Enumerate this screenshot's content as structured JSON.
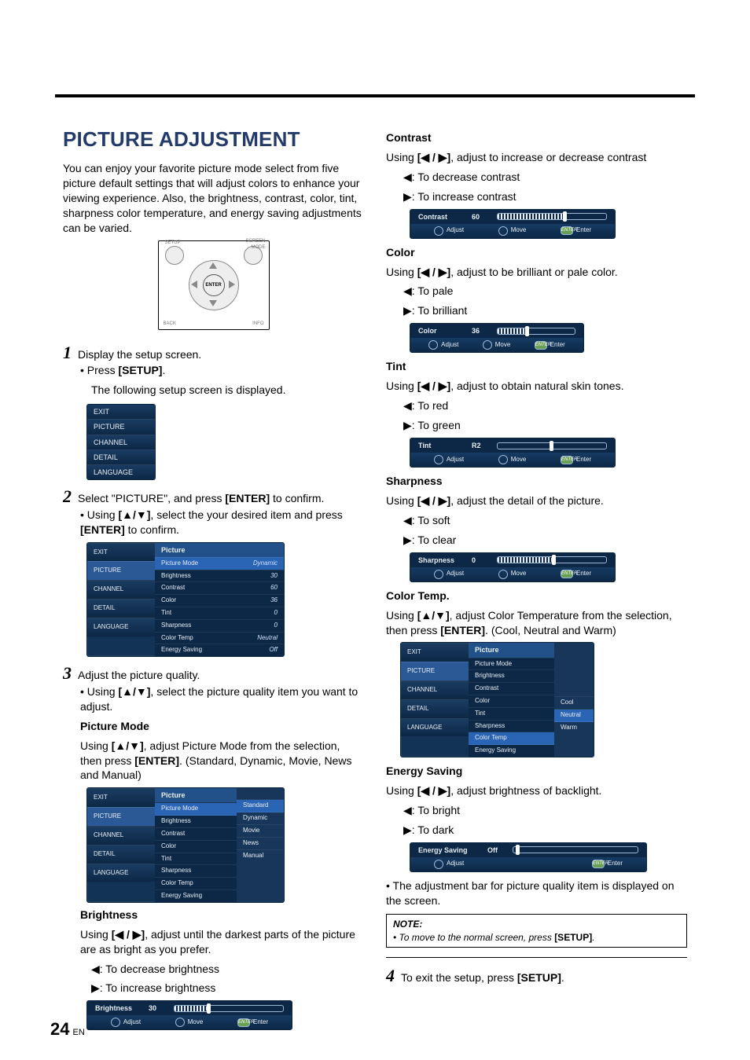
{
  "page": {
    "number": "24",
    "suffix": "EN"
  },
  "title": "PICTURE ADJUSTMENT",
  "intro": "You can enjoy your favorite picture mode select from five picture default settings that will adjust colors to enhance your viewing experience. Also, the brightness, contrast, color, tint, sharpness color temperature, and energy saving adjustments can be varied.",
  "remote": {
    "setup": "SETUP",
    "back": "BACK",
    "screen": "SCREEN MODE",
    "info": "INFO",
    "enter": "ENTER"
  },
  "steps": {
    "s1": {
      "num": "1",
      "text": "Display the setup screen.",
      "b1a": "• Press ",
      "b1b": "[SETUP]",
      "b1c": ".",
      "b2": "The following setup screen is displayed."
    },
    "s2": {
      "num": "2",
      "t1": "Select \"PICTURE\", and press ",
      "t2": "[ENTER]",
      "t3": " to confirm.",
      "b1a": "• Using ",
      "b1b": "[▲/▼]",
      "b1c": ", select the your desired item and press ",
      "b1d": "[ENTER]",
      "b1e": " to confirm."
    },
    "s3": {
      "num": "3",
      "text": "Adjust the picture quality.",
      "b1a": "• Using ",
      "b1b": "[▲/▼]",
      "b1c": ", select the picture quality item you want to adjust."
    },
    "s4": {
      "num": "4",
      "t1": "To exit the setup, press ",
      "t2": "[SETUP]",
      "t3": "."
    }
  },
  "menu": {
    "items": [
      "EXIT",
      "PICTURE",
      "CHANNEL",
      "DETAIL",
      "LANGUAGE"
    ]
  },
  "pictureTable": {
    "header": "Picture",
    "rows": [
      {
        "k": "Picture Mode",
        "v": "Dynamic"
      },
      {
        "k": "Brightness",
        "v": "30"
      },
      {
        "k": "Contrast",
        "v": "60"
      },
      {
        "k": "Color",
        "v": "36"
      },
      {
        "k": "Tint",
        "v": "0"
      },
      {
        "k": "Sharpness",
        "v": "0"
      },
      {
        "k": "Color Temp",
        "v": "Neutral"
      },
      {
        "k": "Energy Saving",
        "v": "Off"
      }
    ]
  },
  "pictureModeTable": {
    "header": "Picture",
    "rows": [
      "Picture Mode",
      "Brightness",
      "Contrast",
      "Color",
      "Tint",
      "Sharpness",
      "Color Temp",
      "Energy Saving"
    ],
    "options": [
      "Standard",
      "Dynamic",
      "Movie",
      "News",
      "Manual"
    ]
  },
  "colorTempTable": {
    "header": "Picture",
    "rows": [
      "Picture Mode",
      "Brightness",
      "Contrast",
      "Color",
      "Tint",
      "Sharpness",
      "Color Temp",
      "Energy Saving"
    ],
    "options": [
      "Cool",
      "Neutral",
      "Warm"
    ]
  },
  "sections": {
    "pmode": {
      "h": "Picture Mode",
      "l1a": "Using ",
      "l1b": "[▲/▼]",
      "l1c": ", adjust Picture Mode from the selection, then press ",
      "l1d": "[ENTER]",
      "l1e": ". (Standard, Dynamic, Movie, News and Manual)"
    },
    "bright": {
      "h": "Brightness",
      "l1a": "Using ",
      "l1b": "[◀ / ▶]",
      "l1c": ", adjust until the darkest parts of the picture are as bright as you prefer.",
      "d1": "◀: To decrease brightness",
      "d2": "▶: To increase brightness"
    },
    "contrast": {
      "h": "Contrast",
      "l1a": "Using ",
      "l1b": "[◀ / ▶]",
      "l1c": ", adjust to increase or decrease contrast",
      "d1": "◀: To decrease contrast",
      "d2": "▶: To increase contrast"
    },
    "color": {
      "h": "Color",
      "l1a": "Using ",
      "l1b": "[◀ / ▶]",
      "l1c": ", adjust to be brilliant or pale color.",
      "d1": "◀: To pale",
      "d2": "▶: To brilliant"
    },
    "tint": {
      "h": "Tint",
      "l1a": "Using ",
      "l1b": "[◀ / ▶]",
      "l1c": ", adjust to obtain natural skin tones.",
      "d1": "◀: To red",
      "d2": "▶: To green"
    },
    "sharp": {
      "h": "Sharpness",
      "l1a": "Using ",
      "l1b": "[◀ / ▶]",
      "l1c": ", adjust the detail of the picture.",
      "d1": "◀: To soft",
      "d2": "▶: To clear"
    },
    "ctemp": {
      "h": "Color Temp.",
      "l1a": "Using ",
      "l1b": "[▲/▼]",
      "l1c": ", adjust Color Temperature from the selection, then press ",
      "l1d": "[ENTER]",
      "l1e": ". (Cool, Neutral and Warm)"
    },
    "energy": {
      "h": "Energy Saving",
      "l1a": "Using ",
      "l1b": "[◀ / ▶]",
      "l1c": ", adjust brightness of backlight.",
      "d1": "◀: To bright",
      "d2": "▶: To dark",
      "note": "• The adjustment bar for picture quality item is displayed on the screen."
    }
  },
  "bars": {
    "brightness": {
      "label": "Brightness",
      "val": "30",
      "fill": 30,
      "actions": [
        "Adjust",
        "Move",
        "Enter"
      ]
    },
    "contrast": {
      "label": "Contrast",
      "val": "60",
      "fill": 60,
      "actions": [
        "Adjust",
        "Move",
        "Enter"
      ]
    },
    "color": {
      "label": "Color",
      "val": "36",
      "fill": 36,
      "actions": [
        "Adjust",
        "Move",
        "Enter"
      ]
    },
    "tint": {
      "label": "Tint",
      "val": "R2",
      "fill": 48,
      "actions": [
        "Adjust",
        "Move",
        "Enter"
      ]
    },
    "sharp": {
      "label": "Sharpness",
      "val": "0",
      "fill": 50,
      "actions": [
        "Adjust",
        "Move",
        "Enter"
      ]
    },
    "energy": {
      "label": "Energy Saving",
      "val": "Off",
      "fill": 2,
      "actions": [
        "Adjust",
        "Enter"
      ]
    }
  },
  "noteBox": {
    "h": "NOTE:",
    "b1": "• To move to the normal screen, press ",
    "b2": "[SETUP]",
    "b3": "."
  },
  "osd": {
    "enter": "ENTER"
  }
}
